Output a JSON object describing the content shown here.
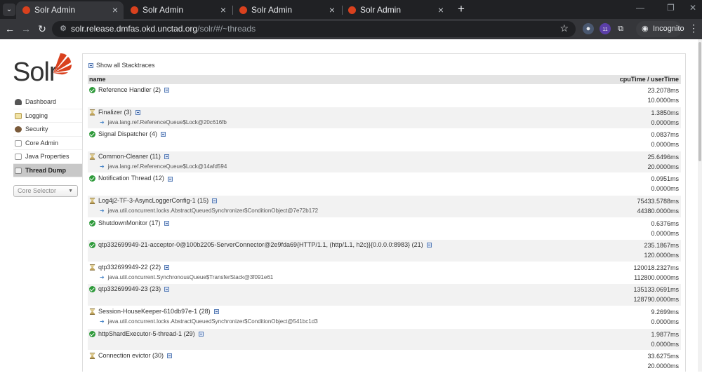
{
  "browser": {
    "tabs": [
      {
        "title": "Solr Admin",
        "active": true
      },
      {
        "title": "Solr Admin",
        "active": false
      },
      {
        "title": "Solr Admin",
        "active": false
      },
      {
        "title": "Solr Admin",
        "active": false
      }
    ],
    "url_host": "solr.release.dmfas.okd.unctad.org",
    "url_path": "/solr/#/~threads",
    "incognito_label": "Incognito",
    "extension_badge": "11"
  },
  "logo_text": "Solr",
  "sidebar": {
    "items": [
      {
        "label": "Dashboard"
      },
      {
        "label": "Logging"
      },
      {
        "label": "Security"
      },
      {
        "label": "Core Admin"
      },
      {
        "label": "Java Properties"
      },
      {
        "label": "Thread Dump",
        "active": true
      }
    ],
    "core_selector": "Core Selector"
  },
  "threads": {
    "show_all_label": "Show all Stacktraces",
    "header": {
      "name": "name",
      "time": "cpuTime / userTime"
    },
    "rows": [
      {
        "name": "Reference Handler (2)",
        "state": "runnable",
        "lock": "",
        "cpu": "23.2078ms",
        "user": "10.0000ms"
      },
      {
        "name": "Finalizer (3)",
        "state": "waiting",
        "lock": "java.lang.ref.ReferenceQueue$Lock@20c616fb",
        "cpu": "1.3850ms",
        "user": "0.0000ms"
      },
      {
        "name": "Signal Dispatcher (4)",
        "state": "runnable",
        "lock": "",
        "cpu": "0.0837ms",
        "user": "0.0000ms"
      },
      {
        "name": "Common-Cleaner (11)",
        "state": "waiting",
        "lock": "java.lang.ref.ReferenceQueue$Lock@14afd594",
        "cpu": "25.6496ms",
        "user": "20.0000ms"
      },
      {
        "name": "Notification Thread (12)",
        "state": "runnable",
        "lock": "",
        "cpu": "0.0951ms",
        "user": "0.0000ms"
      },
      {
        "name": "Log4j2-TF-3-AsyncLoggerConfig-1 (15)",
        "state": "waiting",
        "lock": "java.util.concurrent.locks.AbstractQueuedSynchronizer$ConditionObject@7e72b172",
        "cpu": "75433.5788ms",
        "user": "44380.0000ms"
      },
      {
        "name": "ShutdownMonitor (17)",
        "state": "runnable",
        "lock": "",
        "cpu": "0.6376ms",
        "user": "0.0000ms"
      },
      {
        "name": "qtp332699949-21-acceptor-0@100b2205-ServerConnector@2e9fda69{HTTP/1.1, (http/1.1, h2c)}{0.0.0.0:8983} (21)",
        "state": "runnable",
        "lock": "",
        "cpu": "235.1867ms",
        "user": "120.0000ms"
      },
      {
        "name": "qtp332699949-22 (22)",
        "state": "waiting",
        "lock": "java.util.concurrent.SynchronousQueue$TransferStack@3f091e61",
        "cpu": "120018.2327ms",
        "user": "112800.0000ms"
      },
      {
        "name": "qtp332699949-23 (23)",
        "state": "runnable",
        "lock": "",
        "cpu": "135133.0691ms",
        "user": "128790.0000ms"
      },
      {
        "name": "Session-HouseKeeper-610db97e-1 (28)",
        "state": "waiting",
        "lock": "java.util.concurrent.locks.AbstractQueuedSynchronizer$ConditionObject@541bc1d3",
        "cpu": "9.2699ms",
        "user": "0.0000ms"
      },
      {
        "name": "httpShardExecutor-5-thread-1 (29)",
        "state": "runnable",
        "lock": "",
        "cpu": "1.9877ms",
        "user": "0.0000ms"
      },
      {
        "name": "Connection evictor (30)",
        "state": "waiting",
        "lock": "",
        "cpu": "33.6275ms",
        "user": "20.0000ms"
      }
    ]
  }
}
